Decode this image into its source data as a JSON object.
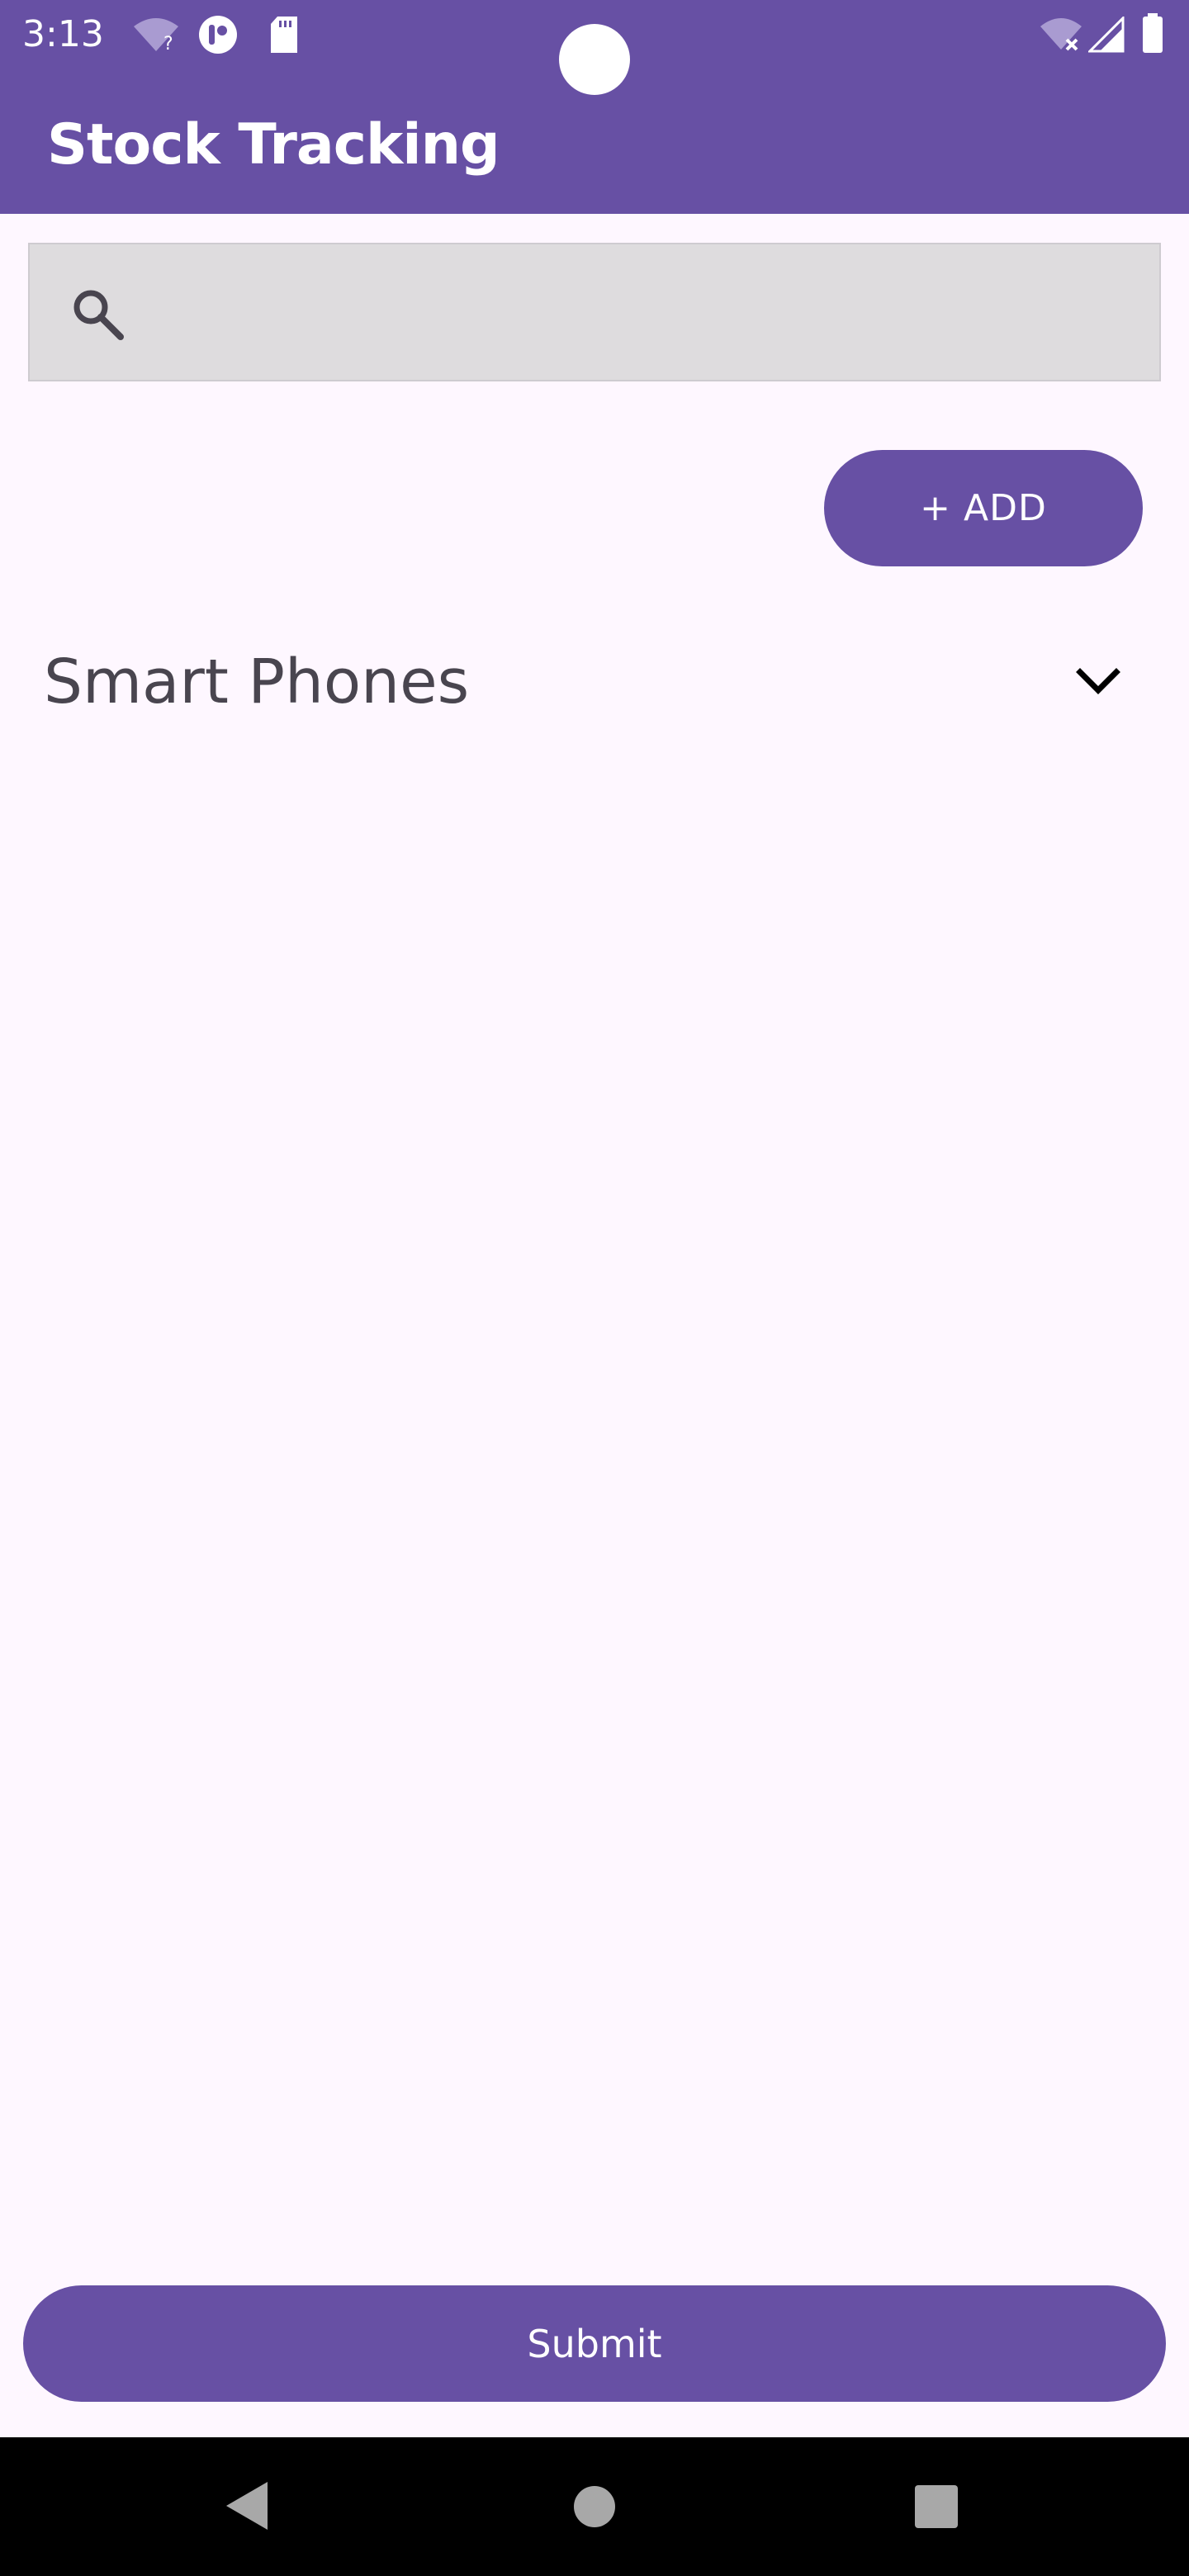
{
  "status_bar": {
    "time": "3:13",
    "icons": [
      "wifi-unknown-icon",
      "app-notification-icon",
      "sd-card-icon",
      "wifi-off-icon",
      "signal-icon",
      "battery-icon"
    ]
  },
  "app_bar": {
    "title": "Stock Tracking"
  },
  "search": {
    "value": "",
    "placeholder": "",
    "icon": "search-icon"
  },
  "actions": {
    "add_label": "+ ADD"
  },
  "category": {
    "selected": "Smart Phones",
    "icon": "chevron-down-icon"
  },
  "footer": {
    "submit_label": "Submit"
  },
  "navigation": {
    "buttons": [
      "back-icon",
      "home-icon",
      "recents-icon"
    ]
  },
  "colors": {
    "primary": "#6750A4",
    "background": "#FEF7FF",
    "search_background": "#DEDCDE",
    "text_secondary": "#49454F",
    "nav_background": "#000000"
  }
}
